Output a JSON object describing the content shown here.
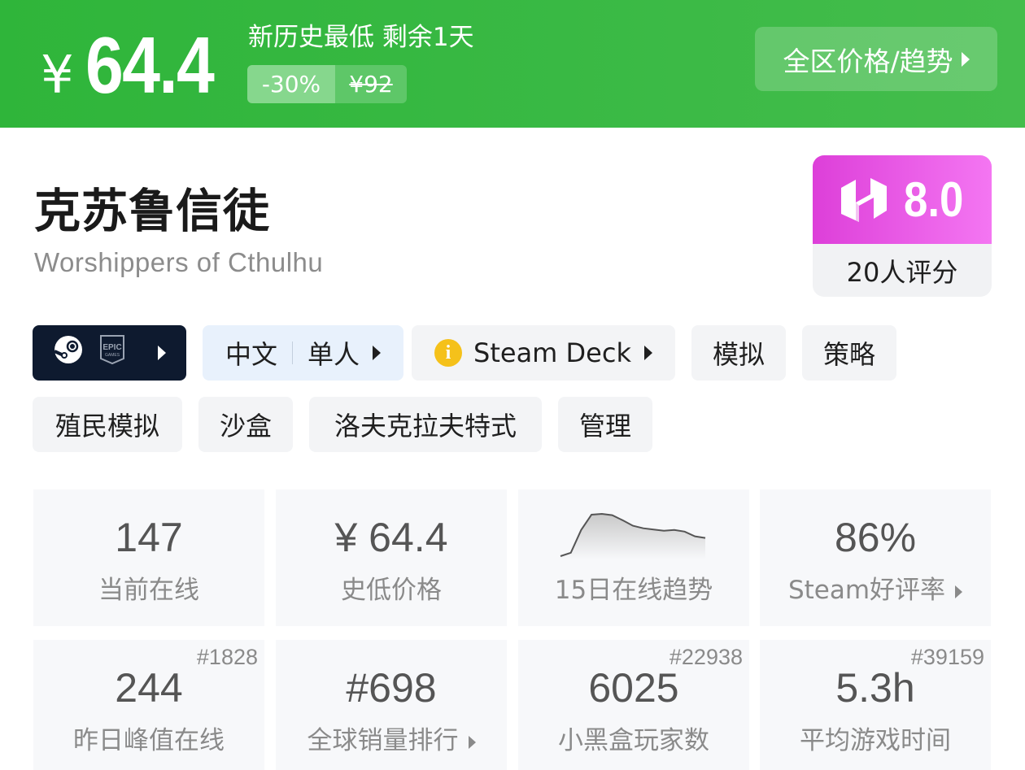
{
  "banner": {
    "currency": "¥",
    "price": "64.4",
    "deal_title": "新历史最低 剩余1天",
    "discount": "-30%",
    "original_price": "¥92",
    "region_button": "全区价格/趋势"
  },
  "game": {
    "title_cn": "克苏鲁信徒",
    "title_en": "Worshippers of Cthulhu"
  },
  "score": {
    "value": "8.0",
    "count_label": "20人评分"
  },
  "tags": {
    "language": "中文",
    "mode": "单人",
    "steam_deck": "Steam Deck",
    "genres": [
      "模拟",
      "策略",
      "殖民模拟",
      "沙盒",
      "洛夫克拉夫特式",
      "管理"
    ]
  },
  "stats": {
    "current_online": {
      "value": "147",
      "label": "当前在线"
    },
    "lowest_price": {
      "value": "¥ 64.4",
      "label": "史低价格"
    },
    "online_trend": {
      "label": "15日在线趋势",
      "points": [
        0,
        0.08,
        0.62,
        0.98,
        1.0,
        0.97,
        0.85,
        0.72,
        0.66,
        0.63,
        0.6,
        0.62,
        0.58,
        0.47,
        0.43
      ]
    },
    "steam_rating": {
      "value": "86%",
      "label": "Steam好评率"
    },
    "peak_online": {
      "value": "244",
      "label": "昨日峰值在线",
      "rank": "#1828"
    },
    "sales_rank": {
      "value": "#698",
      "label": "全球销量排行"
    },
    "players": {
      "value": "6025",
      "label": "小黑盒玩家数",
      "rank": "#22938"
    },
    "avg_playtime": {
      "value": "5.3h",
      "label": "平均游戏时间",
      "rank": "#39159"
    }
  },
  "colors": {
    "banner_green": "#35b740",
    "score_magenta": "#e74ee4",
    "platform_dark": "#0e1a2f",
    "deck_info_yellow": "#f5c11a"
  }
}
